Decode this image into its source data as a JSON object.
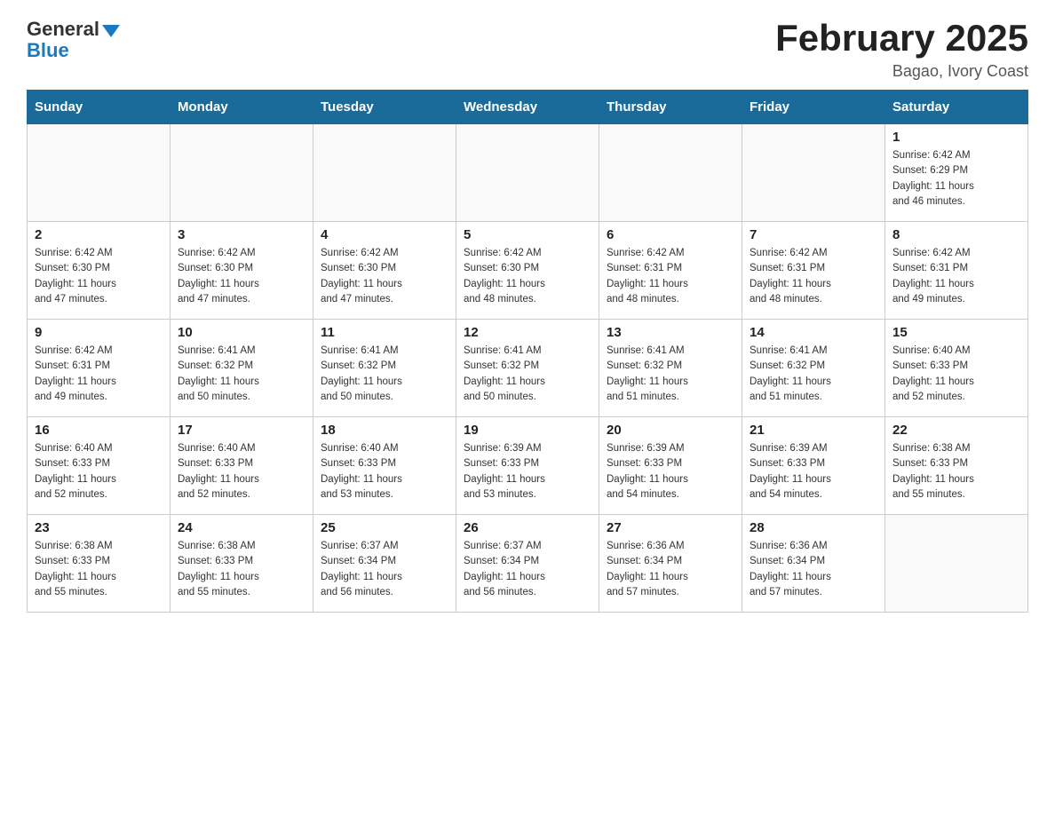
{
  "header": {
    "logo_general": "General",
    "logo_blue": "Blue",
    "month_title": "February 2025",
    "location": "Bagao, Ivory Coast"
  },
  "weekdays": [
    "Sunday",
    "Monday",
    "Tuesday",
    "Wednesday",
    "Thursday",
    "Friday",
    "Saturday"
  ],
  "weeks": [
    [
      {
        "day": "",
        "info": ""
      },
      {
        "day": "",
        "info": ""
      },
      {
        "day": "",
        "info": ""
      },
      {
        "day": "",
        "info": ""
      },
      {
        "day": "",
        "info": ""
      },
      {
        "day": "",
        "info": ""
      },
      {
        "day": "1",
        "info": "Sunrise: 6:42 AM\nSunset: 6:29 PM\nDaylight: 11 hours\nand 46 minutes."
      }
    ],
    [
      {
        "day": "2",
        "info": "Sunrise: 6:42 AM\nSunset: 6:30 PM\nDaylight: 11 hours\nand 47 minutes."
      },
      {
        "day": "3",
        "info": "Sunrise: 6:42 AM\nSunset: 6:30 PM\nDaylight: 11 hours\nand 47 minutes."
      },
      {
        "day": "4",
        "info": "Sunrise: 6:42 AM\nSunset: 6:30 PM\nDaylight: 11 hours\nand 47 minutes."
      },
      {
        "day": "5",
        "info": "Sunrise: 6:42 AM\nSunset: 6:30 PM\nDaylight: 11 hours\nand 48 minutes."
      },
      {
        "day": "6",
        "info": "Sunrise: 6:42 AM\nSunset: 6:31 PM\nDaylight: 11 hours\nand 48 minutes."
      },
      {
        "day": "7",
        "info": "Sunrise: 6:42 AM\nSunset: 6:31 PM\nDaylight: 11 hours\nand 48 minutes."
      },
      {
        "day": "8",
        "info": "Sunrise: 6:42 AM\nSunset: 6:31 PM\nDaylight: 11 hours\nand 49 minutes."
      }
    ],
    [
      {
        "day": "9",
        "info": "Sunrise: 6:42 AM\nSunset: 6:31 PM\nDaylight: 11 hours\nand 49 minutes."
      },
      {
        "day": "10",
        "info": "Sunrise: 6:41 AM\nSunset: 6:32 PM\nDaylight: 11 hours\nand 50 minutes."
      },
      {
        "day": "11",
        "info": "Sunrise: 6:41 AM\nSunset: 6:32 PM\nDaylight: 11 hours\nand 50 minutes."
      },
      {
        "day": "12",
        "info": "Sunrise: 6:41 AM\nSunset: 6:32 PM\nDaylight: 11 hours\nand 50 minutes."
      },
      {
        "day": "13",
        "info": "Sunrise: 6:41 AM\nSunset: 6:32 PM\nDaylight: 11 hours\nand 51 minutes."
      },
      {
        "day": "14",
        "info": "Sunrise: 6:41 AM\nSunset: 6:32 PM\nDaylight: 11 hours\nand 51 minutes."
      },
      {
        "day": "15",
        "info": "Sunrise: 6:40 AM\nSunset: 6:33 PM\nDaylight: 11 hours\nand 52 minutes."
      }
    ],
    [
      {
        "day": "16",
        "info": "Sunrise: 6:40 AM\nSunset: 6:33 PM\nDaylight: 11 hours\nand 52 minutes."
      },
      {
        "day": "17",
        "info": "Sunrise: 6:40 AM\nSunset: 6:33 PM\nDaylight: 11 hours\nand 52 minutes."
      },
      {
        "day": "18",
        "info": "Sunrise: 6:40 AM\nSunset: 6:33 PM\nDaylight: 11 hours\nand 53 minutes."
      },
      {
        "day": "19",
        "info": "Sunrise: 6:39 AM\nSunset: 6:33 PM\nDaylight: 11 hours\nand 53 minutes."
      },
      {
        "day": "20",
        "info": "Sunrise: 6:39 AM\nSunset: 6:33 PM\nDaylight: 11 hours\nand 54 minutes."
      },
      {
        "day": "21",
        "info": "Sunrise: 6:39 AM\nSunset: 6:33 PM\nDaylight: 11 hours\nand 54 minutes."
      },
      {
        "day": "22",
        "info": "Sunrise: 6:38 AM\nSunset: 6:33 PM\nDaylight: 11 hours\nand 55 minutes."
      }
    ],
    [
      {
        "day": "23",
        "info": "Sunrise: 6:38 AM\nSunset: 6:33 PM\nDaylight: 11 hours\nand 55 minutes."
      },
      {
        "day": "24",
        "info": "Sunrise: 6:38 AM\nSunset: 6:33 PM\nDaylight: 11 hours\nand 55 minutes."
      },
      {
        "day": "25",
        "info": "Sunrise: 6:37 AM\nSunset: 6:34 PM\nDaylight: 11 hours\nand 56 minutes."
      },
      {
        "day": "26",
        "info": "Sunrise: 6:37 AM\nSunset: 6:34 PM\nDaylight: 11 hours\nand 56 minutes."
      },
      {
        "day": "27",
        "info": "Sunrise: 6:36 AM\nSunset: 6:34 PM\nDaylight: 11 hours\nand 57 minutes."
      },
      {
        "day": "28",
        "info": "Sunrise: 6:36 AM\nSunset: 6:34 PM\nDaylight: 11 hours\nand 57 minutes."
      },
      {
        "day": "",
        "info": ""
      }
    ]
  ]
}
